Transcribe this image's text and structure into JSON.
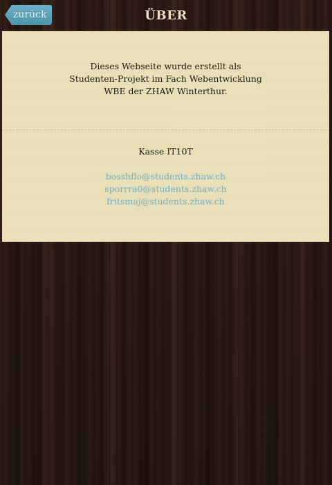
{
  "header": {
    "back_label": "zurück",
    "title": "ÜBER"
  },
  "about": {
    "text": "Dieses Webseite wurde erstellt als Studenten-Projekt im Fach Webentwicklung WBE der ZHAW Winterthur."
  },
  "contact": {
    "class_name": "Kasse IT10T",
    "emails": [
      "bosshflo@students.zhaw.ch",
      "sporrra0@students.zhaw.ch",
      "fritsmaj@students.zhaw.ch"
    ]
  },
  "colors": {
    "accent": "#5fa3bb",
    "panel": "#ebe1b8",
    "link": "#74aec4",
    "background": "#2a1912"
  }
}
